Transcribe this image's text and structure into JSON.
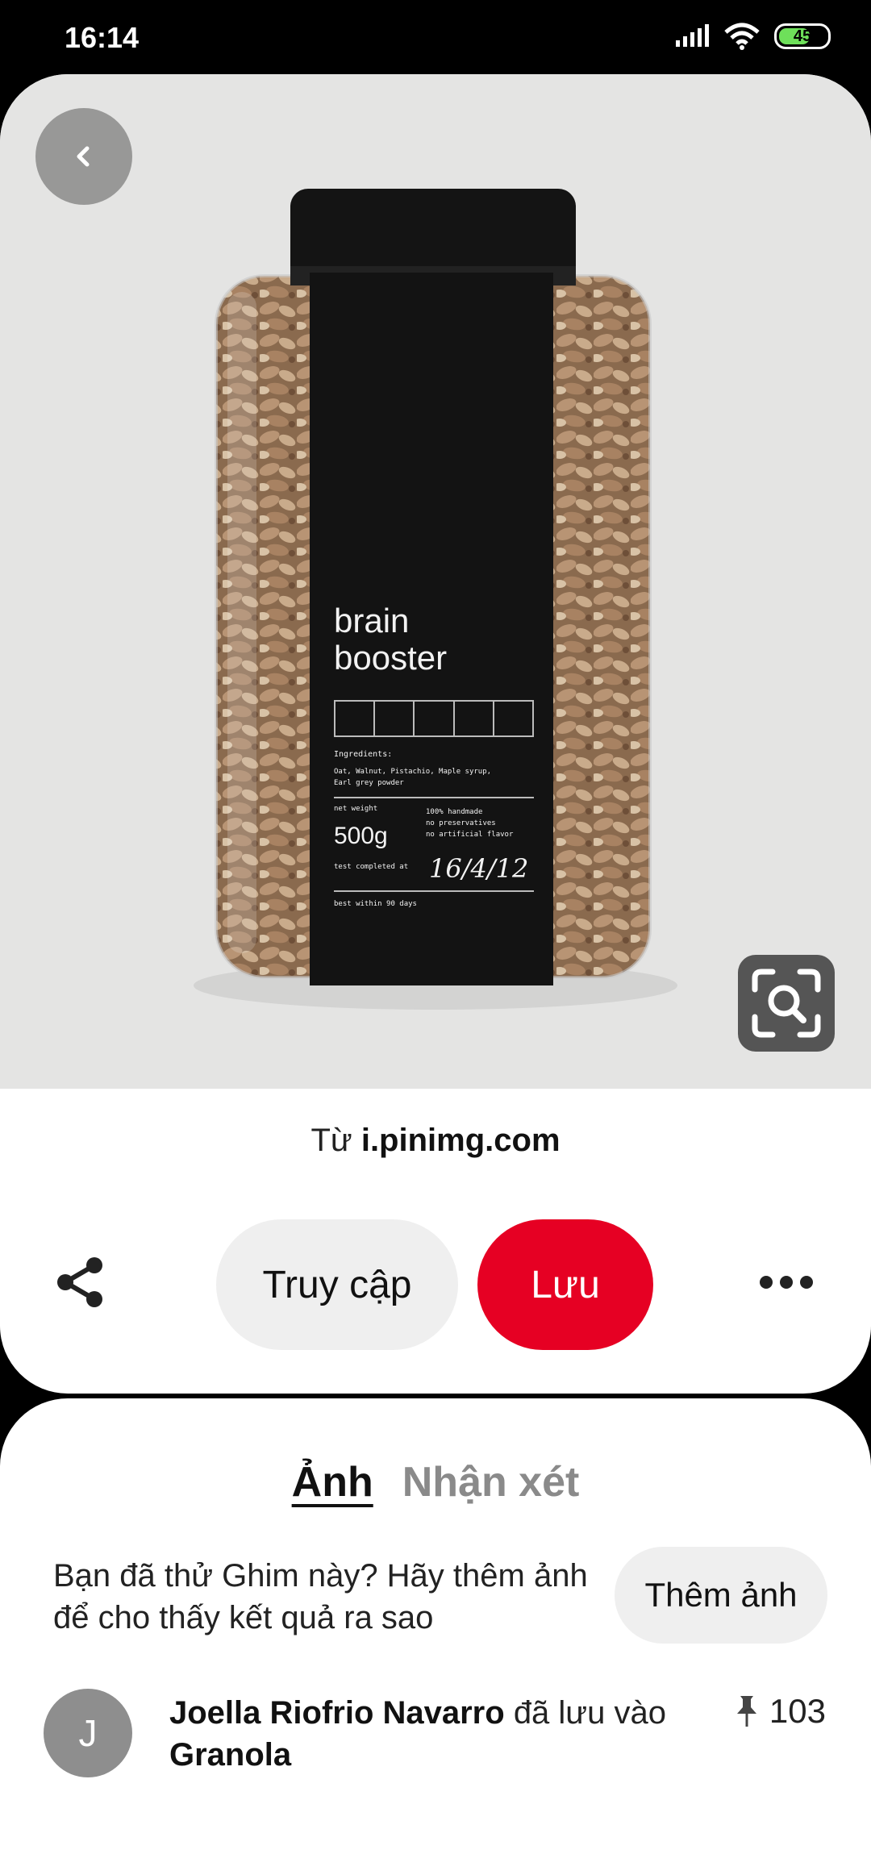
{
  "status_bar": {
    "time": "16:14",
    "battery": "45",
    "battery_color": "#6ee05a"
  },
  "pin": {
    "label": {
      "line1": "brain",
      "line2": "booster",
      "ingredients_title": "Ingredients:",
      "ingredients_line1": "Oat, Walnut, Pistachio, Maple syrup,",
      "ingredients_line2": "Earl grey powder",
      "net_weight_label": "net weight",
      "net_weight": "500g",
      "notes_line1": "100% handmade",
      "notes_line2": "no preservatives",
      "notes_line3": "no artificial flavor",
      "test_label": "test completed at",
      "test_date": "16/4/12",
      "best_within": "best within 90 days"
    },
    "back_icon": "chevron-left-icon",
    "lens_icon": "visual-search-icon"
  },
  "source": {
    "prefix": "Từ",
    "domain": "i.pinimg.com"
  },
  "actions": {
    "share_icon": "share-icon",
    "visit_label": "Truy cập",
    "save_label": "Lưu",
    "more_icon": "more-icon",
    "brand_color": "#e60023"
  },
  "tabs": {
    "photos": "Ảnh",
    "comments": "Nhận xét"
  },
  "tried": {
    "text": "Bạn đã thử Ghim này? Hãy thêm ảnh để cho thấy kết quả ra sao",
    "button": "Thêm ảnh"
  },
  "saver": {
    "avatar_initial": "J",
    "name": "Joella Riofrio Navarro",
    "action": "đã lưu vào",
    "board": "Granola",
    "pin_icon": "pushpin-icon",
    "count": "103"
  }
}
